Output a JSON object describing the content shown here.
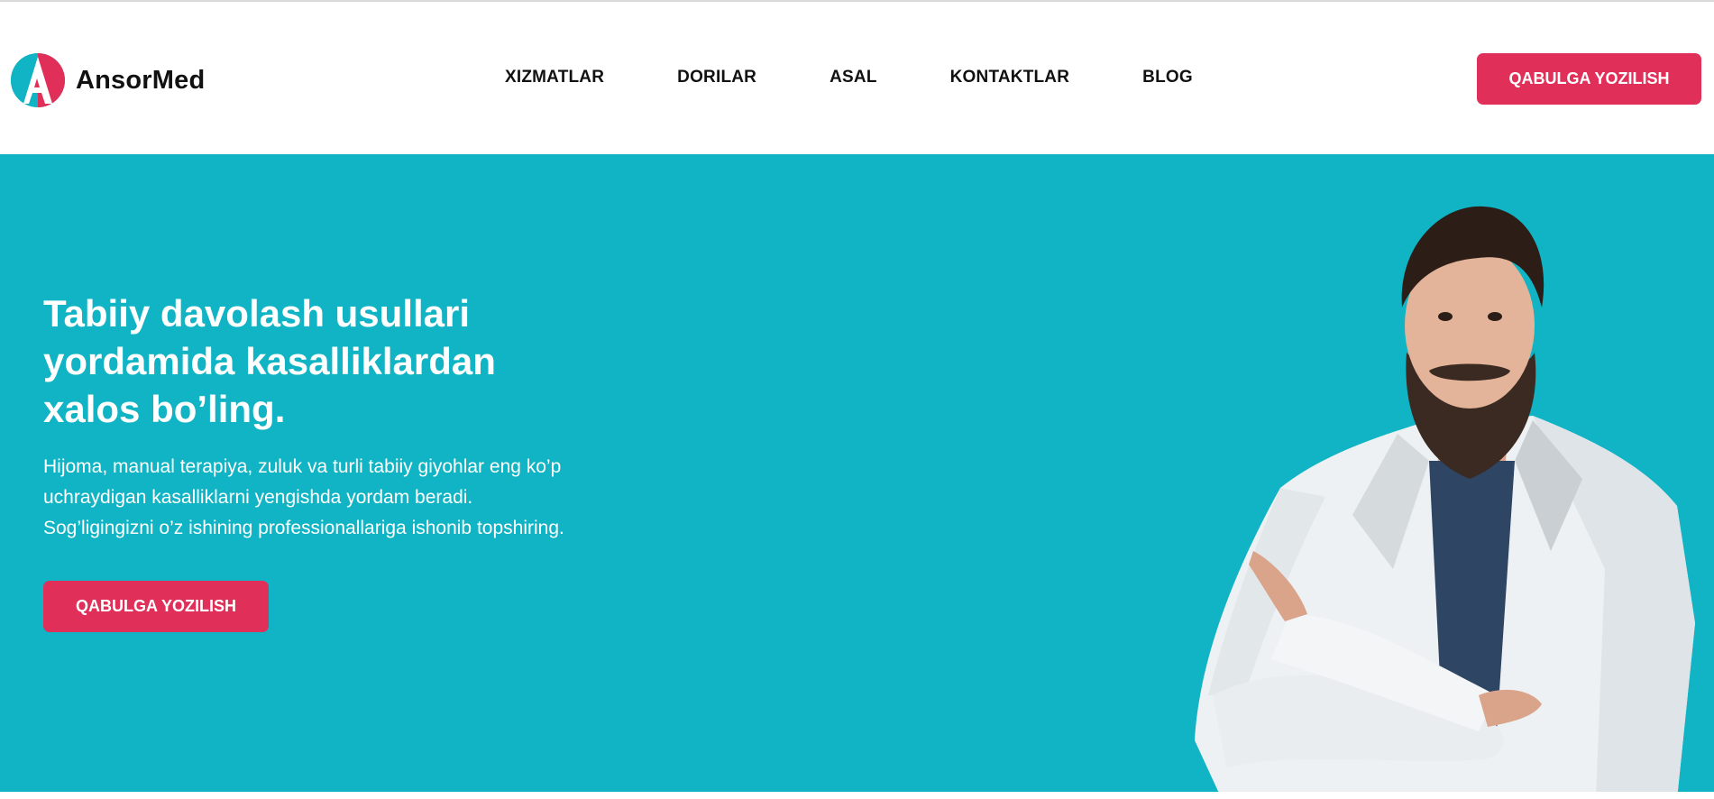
{
  "brand": {
    "name": "AnsorMed",
    "logo_icon": "ansormed-logo-icon",
    "colors": {
      "teal": "#10b4c4",
      "accent": "#e0305a"
    }
  },
  "nav": {
    "items": [
      {
        "label": "XIZMATLAR"
      },
      {
        "label": "DORILAR"
      },
      {
        "label": "ASAL"
      },
      {
        "label": "KONTAKTLAR"
      },
      {
        "label": "BLOG"
      }
    ]
  },
  "header": {
    "cta_label": "QABULGA YOZILISH"
  },
  "hero": {
    "title_lines": [
      "Tabiiy davolash usullari",
      "yordamida kasalliklardan",
      "xalos bo’ling."
    ],
    "description_lines": [
      "Hijoma, manual terapiya, zuluk va turli tabiiy giyohlar eng ko’p",
      "uchraydigan kasalliklarni yengishda yordam beradi.",
      "Sog’ligingizni o’z ishining professionallariga ishonib topshiring."
    ],
    "cta_label": "QABULGA YOZILISH",
    "image": "doctor-portrait-image"
  }
}
